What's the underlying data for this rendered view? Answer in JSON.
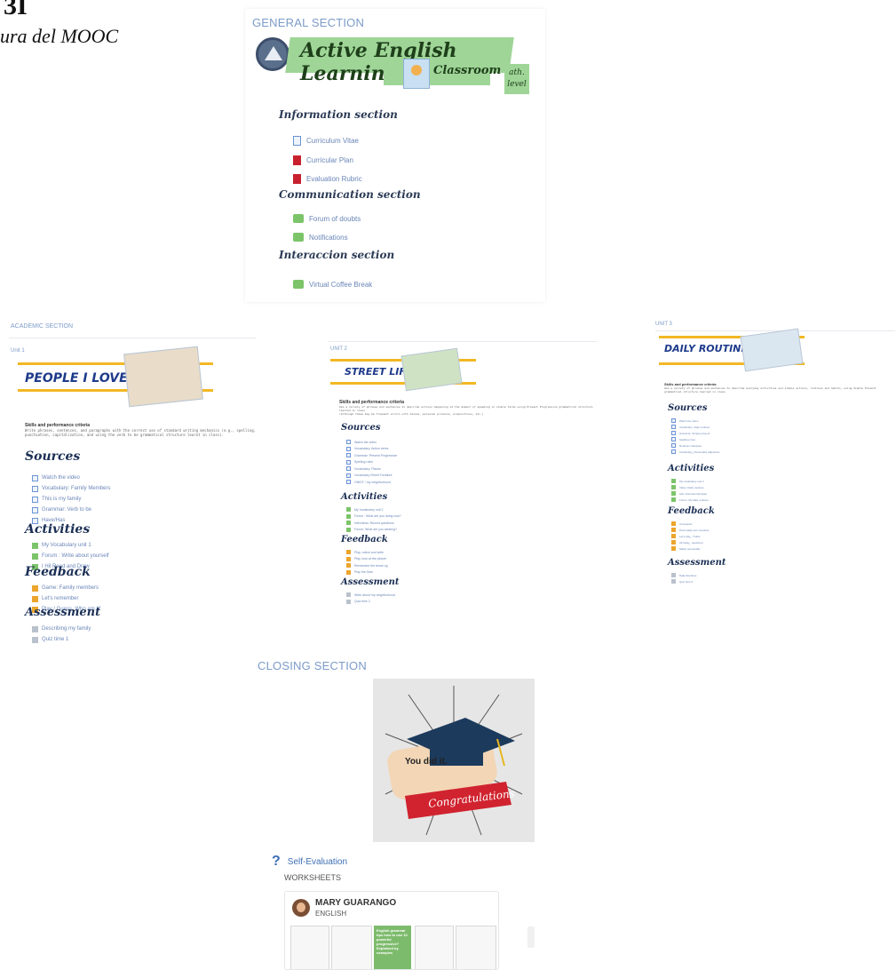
{
  "document": {
    "number": "3I",
    "caption": "ura del MOOC"
  },
  "general_section": {
    "title": "GENERAL SECTION",
    "banner_title": "Active English Learning",
    "banner_subtitle": "Classroom",
    "banner_level": "ath. level",
    "information": {
      "heading": "Information section",
      "items": [
        {
          "label": "Curriculum Vitae",
          "icon": "page-icon"
        },
        {
          "label": "Curricular Plan",
          "icon": "pdf-icon"
        },
        {
          "label": "Evaluation Rubric",
          "icon": "pdf-icon"
        }
      ]
    },
    "communication": {
      "heading": "Communication section",
      "items": [
        {
          "label": "Forum of doubts",
          "icon": "forum-icon"
        },
        {
          "label": "Notifications",
          "icon": "forum-icon"
        }
      ]
    },
    "interaction": {
      "heading": "Interaccion section",
      "items": [
        {
          "label": "Virtual Coffee Break",
          "icon": "forum-icon"
        }
      ]
    }
  },
  "academic_section": {
    "title": "ACADEMIC SECTION",
    "units": [
      {
        "label": "Unit 1",
        "banner": "PEOPLE I LOVE",
        "criteria_title": "Skills and performance criteria",
        "criteria_text": "Write phrases, sentences, and paragraphs with the correct use of standard writing mechanics (e.g., spelling, punctuation, capitalization, and using the verb to be grammatical structure learnt in class).",
        "sources_heading": "Sources",
        "sources": [
          "Watch the video",
          "Vocabulary: Family Members",
          "This is my family",
          "Grammar: Verb to be",
          "Have/Has"
        ],
        "activities_heading": "Activities",
        "activities": [
          "My Vocabulary unit 1",
          "Forum : Write about yourself",
          "I Hil Read and Draw"
        ],
        "feedback_heading": "Feedback",
        "feedback": [
          "Game: Family members",
          "Let's remember",
          "Play / Guess, Who am I?"
        ],
        "assessment_heading": "Assessment",
        "assessment": [
          "Describing my family",
          "Quiz time 1"
        ]
      },
      {
        "label": "UNIT 2",
        "banner": "STREET LIFE",
        "criteria_title": "Skills and performance criteria",
        "criteria_text": "Use a variety of phrases and sentences to describe actions happening at the moment of speaking in simple terms using Present Progressive grammatical structure learned in class",
        "criteria_text2": "(Although these may be frequent errors with tenses, personal pronouns, prepositions, etc.)",
        "sources_heading": "Sources",
        "sources": [
          "Watch the video",
          "Vocabulary: Action verbs",
          "Grammar: Present Progressive",
          "Spelling rules",
          "Vocabulary: Places",
          "Vocabulary Street Furniture",
          "ONIDT / my neighborhood"
        ],
        "activities_heading": "Activities",
        "activities": [
          "My Vocabulary unit 2",
          "Forum : What are you doing now?",
          "Interviews: Recent questions",
          "Forum: What are you wearing?"
        ],
        "feedback_heading": "Feedback",
        "feedback": [
          "Play, notice and write",
          "Play, look at the picture",
          "Remember the tense ng",
          "Play the Gam"
        ],
        "assessment_heading": "Assessment",
        "assessment": [
          "Write about my neighborhood",
          "Quiz time 2"
        ]
      },
      {
        "label": "UNIT 3",
        "banner": "DAILY ROUTINES",
        "criteria_title": "Skills and performance criteria",
        "criteria_text": "Use a variety of phrases and sentences to describe everyday activities and simple actions, routines and habits, using Simple Present grammatical structure learned in class",
        "sources_heading": "Sources",
        "sources": [
          "Watch the video",
          "Vocabulary: daily routines",
          "Grammar: Simple present",
          "Spelling rules",
          "Routines: lifestyles",
          "Vocabulary_Personality adjectives"
        ],
        "activities_heading": "Activities",
        "activities": [
          "My vocabulary unit 3",
          "Video: Daily routines",
          "Ask: Interview lifestyles",
          "Forum: My daily routines"
        ],
        "feedback_heading": "Feedback",
        "feedback": [
          "Crossword",
          "Personality test complete",
          "Let's play_ Truths",
          "All today_ questions",
          "Match personality"
        ],
        "assessment_heading": "Assessment",
        "assessment": [
          "Daily Routines",
          "Quiz time 3"
        ]
      }
    ]
  },
  "closing_section": {
    "title": "CLOSING SECTION",
    "image_text": "You did it.",
    "ribbon_text": "Congratulations",
    "self_eval": "Self-Evaluation",
    "worksheets": "WORKSHEETS",
    "card": {
      "name": "MARY GUARANGO",
      "subject": "ENGLISH",
      "green_text": "English grammar tips how to use 10 powerful progressive? Explained by examples"
    }
  },
  "colors": {
    "section_title": "#7c9bc9",
    "banner_green": "#9fd597",
    "unit_blue": "#1d3a8a",
    "accent_yellow": "#f2b824",
    "ribbon_red": "#d0232f"
  }
}
